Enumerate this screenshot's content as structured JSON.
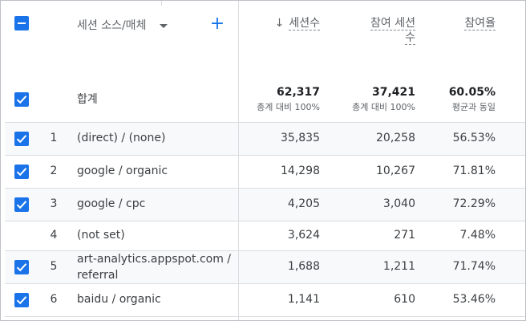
{
  "header": {
    "dimension_label": "세션 소스/매체",
    "add_symbol": "+",
    "sort_arrow": "↓",
    "columns": [
      {
        "label_line1": "세션수",
        "label_line2": ""
      },
      {
        "label_line1": "참여 세션",
        "label_line2": "수"
      },
      {
        "label_line1": "참여율",
        "label_line2": ""
      }
    ]
  },
  "totals": {
    "label": "합계",
    "sessions": "62,317",
    "sessions_sub": "총계 대비 100%",
    "engaged": "37,421",
    "engaged_sub": "총계 대비 100%",
    "rate": "60.05%",
    "rate_sub": "평균과 동일"
  },
  "rows": [
    {
      "num": "1",
      "source": "(direct) / (none)",
      "source2": "",
      "sessions": "35,835",
      "engaged": "20,258",
      "rate": "56.53%",
      "checked": true
    },
    {
      "num": "2",
      "source": "google / organic",
      "source2": "",
      "sessions": "14,298",
      "engaged": "10,267",
      "rate": "71.81%",
      "checked": true
    },
    {
      "num": "3",
      "source": "google / cpc",
      "source2": "",
      "sessions": "4,205",
      "engaged": "3,040",
      "rate": "72.29%",
      "checked": true
    },
    {
      "num": "4",
      "source": "(not set)",
      "source2": "",
      "sessions": "3,624",
      "engaged": "271",
      "rate": "7.48%",
      "checked": false
    },
    {
      "num": "5",
      "source": "art-analytics.appspot.com /",
      "source2": "referral",
      "sessions": "1,688",
      "engaged": "1,211",
      "rate": "71.74%",
      "checked": true
    },
    {
      "num": "6",
      "source": "baidu / organic",
      "source2": "",
      "sessions": "1,141",
      "engaged": "610",
      "rate": "53.46%",
      "checked": true
    }
  ],
  "colors": {
    "checkbox": "#1a73e8",
    "row_alt": "#f8f9fa",
    "divider": "#dadce0"
  }
}
